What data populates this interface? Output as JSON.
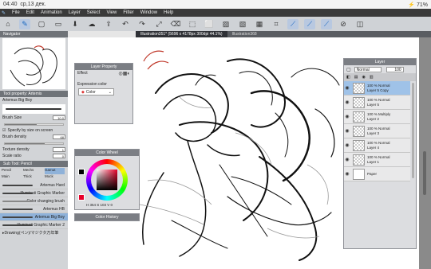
{
  "status": {
    "time": "04:40",
    "date": "ср,13 дек.",
    "battery": "71%"
  },
  "menu": {
    "items": [
      "File",
      "Edit",
      "Animation",
      "Layer",
      "Select",
      "View",
      "Filter",
      "Window",
      "Help"
    ]
  },
  "tabs": [
    {
      "label": "Illustration351* (5696 x 4178px 300dpi 44.1%)"
    },
    {
      "label": "Illustration368"
    }
  ],
  "navigator": {
    "title": "Navigator"
  },
  "tool_property": {
    "title": "Tool property: Artemis",
    "brush_name": "Artemus Big Boy",
    "brush_size_label": "Brush Size",
    "brush_size_value": "10.0",
    "size_check": "Specify by size on screen",
    "brush_density_label": "Brush density",
    "brush_density_value": "68",
    "texture_label": "Texture density",
    "texture_value": "1",
    "scale_label": "Scale ratio",
    "scale_value": "0",
    "size": 0.55,
    "density": 0.68,
    "texture": 0.05,
    "scale": 0.1
  },
  "subtool": {
    "title": "Sub Tool: Pencil",
    "tabs": [
      "Pencil",
      "Mechs",
      "Gamut",
      "Main",
      "Thick",
      "Mock"
    ],
    "brushes": [
      "Artemus Hard",
      "Illuminati Graphic Marker",
      "Color changing brush",
      "Artemus HB",
      "Artemus Big Boy",
      "Illuminati Graphic Marker 2"
    ],
    "selected_index": 4,
    "footer": "▸Drawing(ペン)/マジクタ万年筆"
  },
  "layer_property": {
    "title": "Layer Property",
    "effect_label": "Effect",
    "expression_label": "Expression color",
    "expression_value": "Color"
  },
  "color_wheel": {
    "title": "Color Wheel",
    "values": "H 354  S 103  V 0"
  },
  "color_history": {
    "title": "Color History"
  },
  "layer_panel": {
    "title": "Layer",
    "blend": "Normal",
    "opacity": "100",
    "layers": [
      {
        "line1": "100 % Normal",
        "line2": "Layer 5 Copy",
        "selected": true
      },
      {
        "line1": "100 % Normal",
        "line2": "Layer 5",
        "selected": false
      },
      {
        "line1": "100 % Multiply",
        "line2": "Layer 2",
        "selected": false
      },
      {
        "line1": "100 % Normal",
        "line2": "Layer 3",
        "selected": false
      },
      {
        "line1": "100 % Normal",
        "line2": "Layer 4",
        "selected": false
      },
      {
        "line1": "100 % Normal",
        "line2": "Layer 1",
        "selected": false
      },
      {
        "line1": "",
        "line2": "Paper",
        "selected": false
      }
    ]
  },
  "colors": {
    "accent": "#1565c0",
    "selected_layer": "#9fc2e8",
    "menubar": "#3a3a3a"
  }
}
